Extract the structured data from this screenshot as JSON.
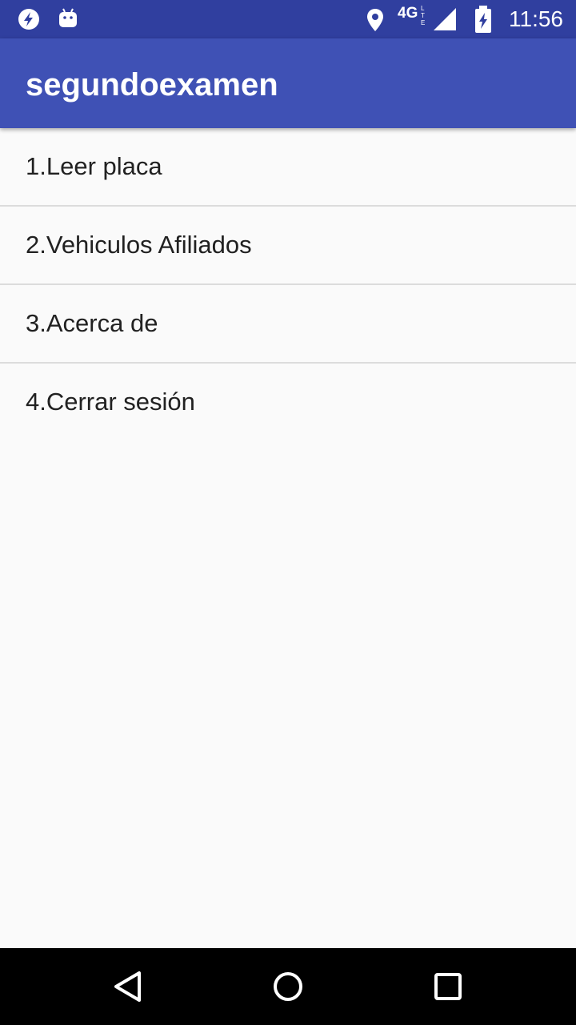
{
  "status_bar": {
    "time": "11:56",
    "network": "4G",
    "network_sub": "LTE",
    "icons": [
      "flash-icon",
      "android-icon",
      "location-icon",
      "signal-icon",
      "battery-charging-icon"
    ]
  },
  "app_bar": {
    "title": "segundoexamen",
    "color": "#3f51b5"
  },
  "menu": {
    "items": [
      {
        "label": "1.Leer placa"
      },
      {
        "label": "2.Vehiculos Afiliados"
      },
      {
        "label": "3.Acerca de"
      },
      {
        "label": "4.Cerrar sesión"
      }
    ]
  },
  "nav_bar": {
    "buttons": [
      "back-icon",
      "home-icon",
      "recents-icon"
    ]
  },
  "colors": {
    "status_bar": "#303f9f",
    "background": "#fafafa",
    "divider": "#dcdcdc"
  }
}
